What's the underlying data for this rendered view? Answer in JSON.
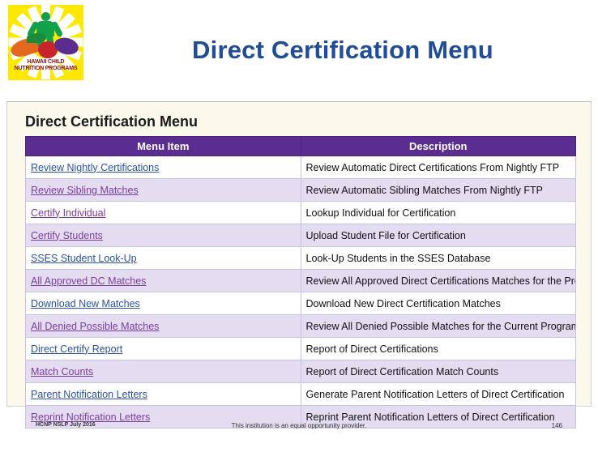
{
  "logo": {
    "alt": "hawaii-child-nutrition-programs-logo",
    "line1": "HAWAII CHILD",
    "line2": "NUTRITION PROGRAMS"
  },
  "title": "Direct Certification Menu",
  "panel": {
    "heading": "Direct Certification Menu",
    "columns": [
      "Menu Item",
      "Description"
    ],
    "rows": [
      {
        "item": "Review Nightly Certifications",
        "desc": "Review Automatic Direct Certifications From Nightly FTP",
        "visited": false
      },
      {
        "item": "Review Sibling Matches",
        "desc": "Review Automatic Sibling Matches From Nightly FTP",
        "visited": true
      },
      {
        "item": "Certify Individual",
        "desc": "Lookup Individual for Certification",
        "visited": true
      },
      {
        "item": "Certify Students",
        "desc": "Upload Student File for Certification",
        "visited": true
      },
      {
        "item": "SSES Student Look-Up",
        "desc": "Look-Up Students in the SSES Database",
        "visited": false
      },
      {
        "item": "All Approved DC Matches",
        "desc": "Review All Approved Direct Certifications Matches for the Program Year",
        "visited": true
      },
      {
        "item": "Download New Matches",
        "desc": "Download New Direct Certification Matches",
        "visited": false
      },
      {
        "item": "All Denied Possible Matches",
        "desc": "Review All Denied Possible Matches for the Current Program Year",
        "visited": true
      },
      {
        "item": "Direct Certify Report",
        "desc": "Report of Direct Certifications",
        "visited": false
      },
      {
        "item": "Match Counts",
        "desc": "Report of Direct Certification Match Counts",
        "visited": true
      },
      {
        "item": "Parent Notification Letters",
        "desc": "Generate Parent Notification Letters of Direct Certification",
        "visited": false
      },
      {
        "item": "Reprint Notification Letters",
        "desc": "Reprint Parent Notification Letters of Direct Certification",
        "visited": true
      }
    ]
  },
  "footer": {
    "left": "HCNP NSLP July 2016",
    "center": "This institution is an equal opportunity provider.",
    "right": "146"
  }
}
